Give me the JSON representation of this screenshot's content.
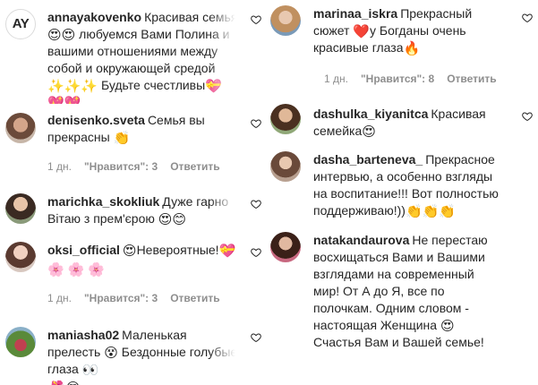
{
  "left_column": [
    {
      "avatar_initials": "AY",
      "username": "annayakovenko",
      "text_lines": [
        "Красивая семья",
        "любуемся Вами Полина и",
        "вашими отношениями между",
        "собой и окружающей средой",
        "Будьте счестливы",
        ""
      ],
      "emoji": {
        "line0": "😍",
        "line1a": "😍",
        "line1b": "😍",
        "line4a": "✨",
        "line4b": "✨",
        "line4c": "✨",
        "line4d": "💝",
        "line5a": "💖",
        "line5b": "💖"
      },
      "meta": null
    },
    {
      "username": "denisenko.sveta",
      "text_lines": [
        "Семья вы",
        "прекрасны"
      ],
      "emoji": {
        "line1": "👏"
      },
      "meta": {
        "time": "1 дн.",
        "likes": "\"Нравится\": 3",
        "reply": "Ответить"
      }
    },
    {
      "username": "marichka_skokliuk",
      "text_lines": [
        "Дуже гарно",
        "Вітаю з прем'єрою"
      ],
      "emoji": {
        "line1a": "😍",
        "line1b": "😊"
      },
      "meta": null
    },
    {
      "username": "oksi_official",
      "text_lines": [
        "Невероятные!",
        ""
      ],
      "emoji": {
        "line0a": "😍",
        "line0b": "💝",
        "line1a": "🌸",
        "line1b": "🌸",
        "line1c": "🌸"
      },
      "meta": {
        "time": "1 дн.",
        "likes": "\"Нравится\": 3",
        "reply": "Ответить"
      }
    },
    {
      "username": "maniasha02",
      "text_lines": [
        "Маленькая",
        "прелесть",
        "Бездонные голубые",
        "глаза"
      ],
      "emoji": {
        "line1": "😵",
        "line3a": "👀",
        "line3b": "🌺",
        "line3c": "😍"
      },
      "meta": null
    }
  ],
  "right_column": [
    {
      "username": "marinaa_iskra",
      "text_lines": [
        "Прекрасный",
        "сюжет",
        "у Богданы очень",
        "красивые глаза"
      ],
      "emoji": {
        "line1": "❤️",
        "line2": "🔥"
      },
      "meta": {
        "time": "1 дн.",
        "likes": "\"Нравится\": 8",
        "reply": "Ответить"
      }
    },
    {
      "username": "dashulka_kiyanitca",
      "text_lines": [
        "Красивая",
        "семейка"
      ],
      "emoji": {
        "line1": "😍"
      },
      "meta": null
    },
    {
      "username": "dasha_barteneva_",
      "text_lines": [
        "Прекрасное",
        "интервью, а особенно взгляды",
        "на воспитание!!! Вот полностью",
        "поддерживаю!))"
      ],
      "emoji": {
        "line3a": "👏",
        "line3b": "👏",
        "line3c": "👏"
      },
      "meta": null
    },
    {
      "username": "natakandaurova",
      "text_lines": [
        "Не перестаю",
        "восхищаться Вами и Вашими",
        "взглядами на современный",
        "мир! От А до Я, все по",
        "полочкам. Одним словом -",
        "настоящая Женщина",
        "Счастья Вам и Вашей семье!"
      ],
      "emoji": {
        "line5": "😍"
      },
      "meta": null
    }
  ],
  "colors": {
    "text": "#262626",
    "meta": "#8e8e8e",
    "heart": "#262626",
    "background": "#ffffff"
  }
}
